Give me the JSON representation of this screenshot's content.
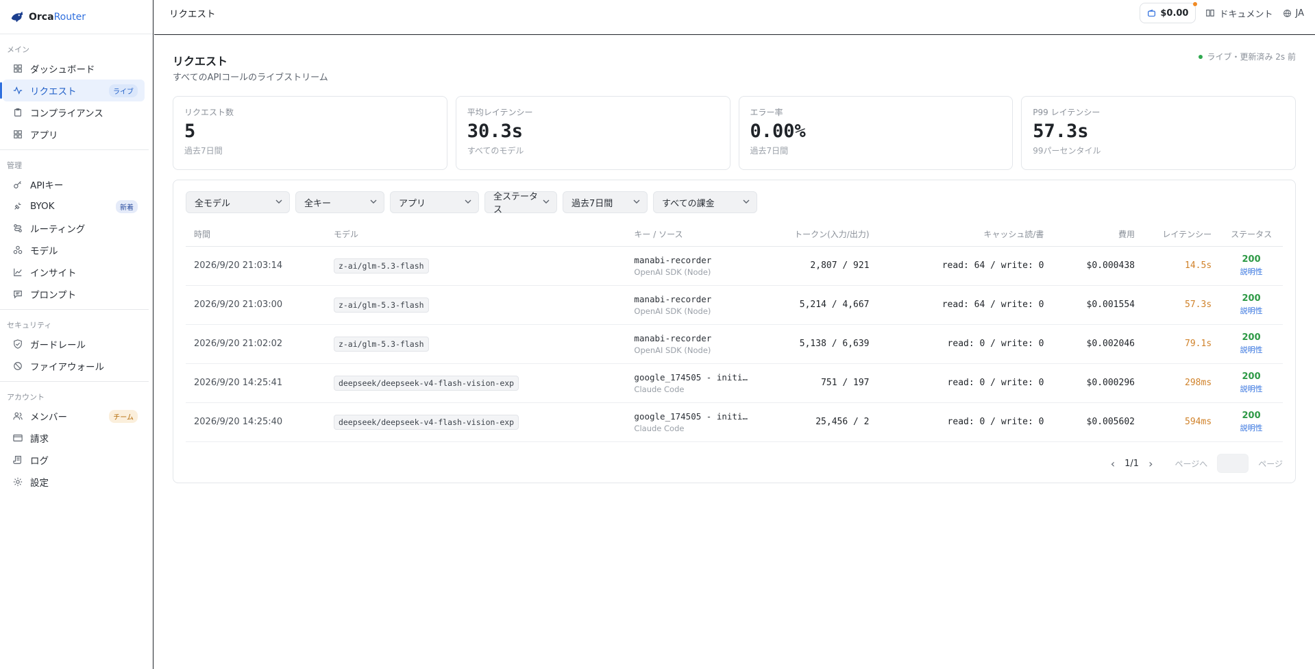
{
  "brand": {
    "name_part1": "Orca",
    "name_part2": "Router"
  },
  "sidebar": {
    "sections": [
      {
        "title": "メイン",
        "items": [
          {
            "label": "ダッシュボード",
            "icon": "grid-icon"
          },
          {
            "label": "リクエスト",
            "icon": "activity-icon",
            "badge": "ライブ",
            "active": true
          },
          {
            "label": "コンプライアンス",
            "icon": "clipboard-icon"
          },
          {
            "label": "アプリ",
            "icon": "apps-icon"
          }
        ]
      },
      {
        "title": "管理",
        "items": [
          {
            "label": "APIキー",
            "icon": "key-icon"
          },
          {
            "label": "BYOK",
            "icon": "plug-icon",
            "badge": "新着"
          },
          {
            "label": "ルーティング",
            "icon": "route-icon"
          },
          {
            "label": "モデル",
            "icon": "models-icon"
          },
          {
            "label": "インサイト",
            "icon": "chart-icon"
          },
          {
            "label": "プロンプト",
            "icon": "message-icon"
          }
        ]
      },
      {
        "title": "セキュリティ",
        "items": [
          {
            "label": "ガードレール",
            "icon": "shield-check-icon"
          },
          {
            "label": "ファイアウォール",
            "icon": "ban-icon"
          }
        ]
      },
      {
        "title": "アカウント",
        "items": [
          {
            "label": "メンバー",
            "icon": "users-icon",
            "badge": "チーム"
          },
          {
            "label": "請求",
            "icon": "card-icon"
          },
          {
            "label": "ログ",
            "icon": "scroll-icon"
          },
          {
            "label": "設定",
            "icon": "gear-icon"
          }
        ]
      }
    ]
  },
  "topbar": {
    "breadcrumb": "リクエスト",
    "credit": "$0.00",
    "docs": "ドキュメント",
    "lang": "JA"
  },
  "page": {
    "title": "リクエスト",
    "subtitle": "すべてのAPIコールのライブストリーム",
    "live_status": "ライブ・更新済み 2s 前"
  },
  "stats": [
    {
      "label": "リクエスト数",
      "value": "5",
      "foot": "過去7日間"
    },
    {
      "label": "平均レイテンシー",
      "value": "30.3s",
      "foot": "すべてのモデル"
    },
    {
      "label": "エラー率",
      "value": "0.00%",
      "foot": "過去7日間"
    },
    {
      "label": "P99 レイテンシー",
      "value": "57.3s",
      "foot": "99パーセンタイル"
    }
  ],
  "filters": [
    "全モデル",
    "全キー",
    "アプリ",
    "全ステータス",
    "過去7日間",
    "すべての課金"
  ],
  "table": {
    "headers": [
      "時間",
      "モデル",
      "キー / ソース",
      "トークン(入力/出力)",
      "キャッシュ読/書",
      "費用",
      "レイテンシー",
      "ステータス"
    ],
    "rows": [
      {
        "time": "2026/9/20 21:03:14",
        "model": "z-ai/glm-5.3-flash",
        "key": "manabi-recorder",
        "source": "OpenAI SDK (Node)",
        "tokens": "2,807 / 921",
        "cache": "read: 64 / write: 0",
        "cost": "$0.000438",
        "latency": "14.5s",
        "status": "200",
        "status_link": "説明性"
      },
      {
        "time": "2026/9/20 21:03:00",
        "model": "z-ai/glm-5.3-flash",
        "key": "manabi-recorder",
        "source": "OpenAI SDK (Node)",
        "tokens": "5,214 / 4,667",
        "cache": "read: 64 / write: 0",
        "cost": "$0.001554",
        "latency": "57.3s",
        "status": "200",
        "status_link": "説明性"
      },
      {
        "time": "2026/9/20 21:02:02",
        "model": "z-ai/glm-5.3-flash",
        "key": "manabi-recorder",
        "source": "OpenAI SDK (Node)",
        "tokens": "5,138 / 6,639",
        "cache": "read: 0 / write: 0",
        "cost": "$0.002046",
        "latency": "79.1s",
        "status": "200",
        "status_link": "説明性"
      },
      {
        "time": "2026/9/20 14:25:41",
        "model": "deepseek/deepseek-v4-flash-vision-exp",
        "key": "google_174505 - initi…",
        "source": "Claude Code",
        "tokens": "751 / 197",
        "cache": "read: 0 / write: 0",
        "cost": "$0.000296",
        "latency": "298ms",
        "status": "200",
        "status_link": "説明性"
      },
      {
        "time": "2026/9/20 14:25:40",
        "model": "deepseek/deepseek-v4-flash-vision-exp",
        "key": "google_174505 - initi…",
        "source": "Claude Code",
        "tokens": "25,456 / 2",
        "cache": "read: 0 / write: 0",
        "cost": "$0.005602",
        "latency": "594ms",
        "status": "200",
        "status_link": "説明性"
      }
    ]
  },
  "pagination": {
    "page": "1/1",
    "goto_label": "ページへ",
    "page_suffix": "ページ"
  }
}
